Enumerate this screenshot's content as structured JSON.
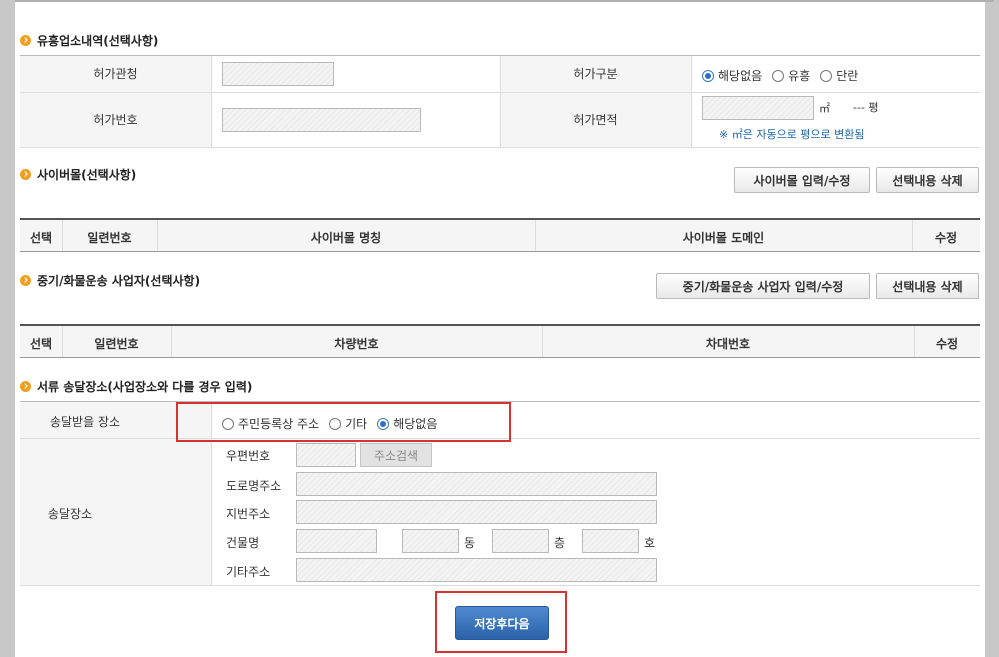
{
  "entertainment": {
    "title": "유흥업소내역(선택사항)",
    "permit_office_label": "허가관청",
    "permit_type_label": "허가구분",
    "permit_number_label": "허가번호",
    "permit_area_label": "허가면적",
    "permit_type_options": [
      {
        "label": "해당없음",
        "checked": true
      },
      {
        "label": "유흥",
        "checked": false
      },
      {
        "label": "단란",
        "checked": false
      }
    ],
    "area_unit": "㎡",
    "pyeong_value": "---",
    "pyeong_unit": "평",
    "area_note": "※ ㎡은 자동으로 평으로 변환됨"
  },
  "cybermall": {
    "title": "사이버몰(선택사항)",
    "edit_button": "사이버몰 입력/수정",
    "delete_button": "선택내용 삭제",
    "columns": [
      "선택",
      "일련번호",
      "사이버몰 명칭",
      "사이버몰 도메인",
      "수정"
    ]
  },
  "transport": {
    "title": "중기/화물운송 사업자(선택사항)",
    "edit_button": "중기/화물운송 사업자 입력/수정",
    "delete_button": "선택내용 삭제",
    "columns": [
      "선택",
      "일련번호",
      "차량번호",
      "차대번호",
      "수정"
    ]
  },
  "delivery": {
    "title": "서류 송달장소(사업장소와 다를 경우 입력)",
    "place_label": "송달받을 장소",
    "place_options": [
      {
        "label": "주민등록상 주소",
        "checked": false
      },
      {
        "label": "기타",
        "checked": false
      },
      {
        "label": "해당없음",
        "checked": true
      }
    ],
    "address_label": "송달장소",
    "zip_label": "우편번호",
    "search_button": "주소검색",
    "road_label": "도로명주소",
    "lot_label": "지번주소",
    "building_label": "건물명",
    "dong_unit": "동",
    "floor_unit": "층",
    "ho_unit": "호",
    "other_label": "기타주소"
  },
  "footer": {
    "save_button": "저장후다음"
  },
  "colors": {
    "accent": "#2a62a8",
    "highlight_border": "#d93030",
    "bullet": "#f0a020",
    "note": "#1d63a8"
  }
}
